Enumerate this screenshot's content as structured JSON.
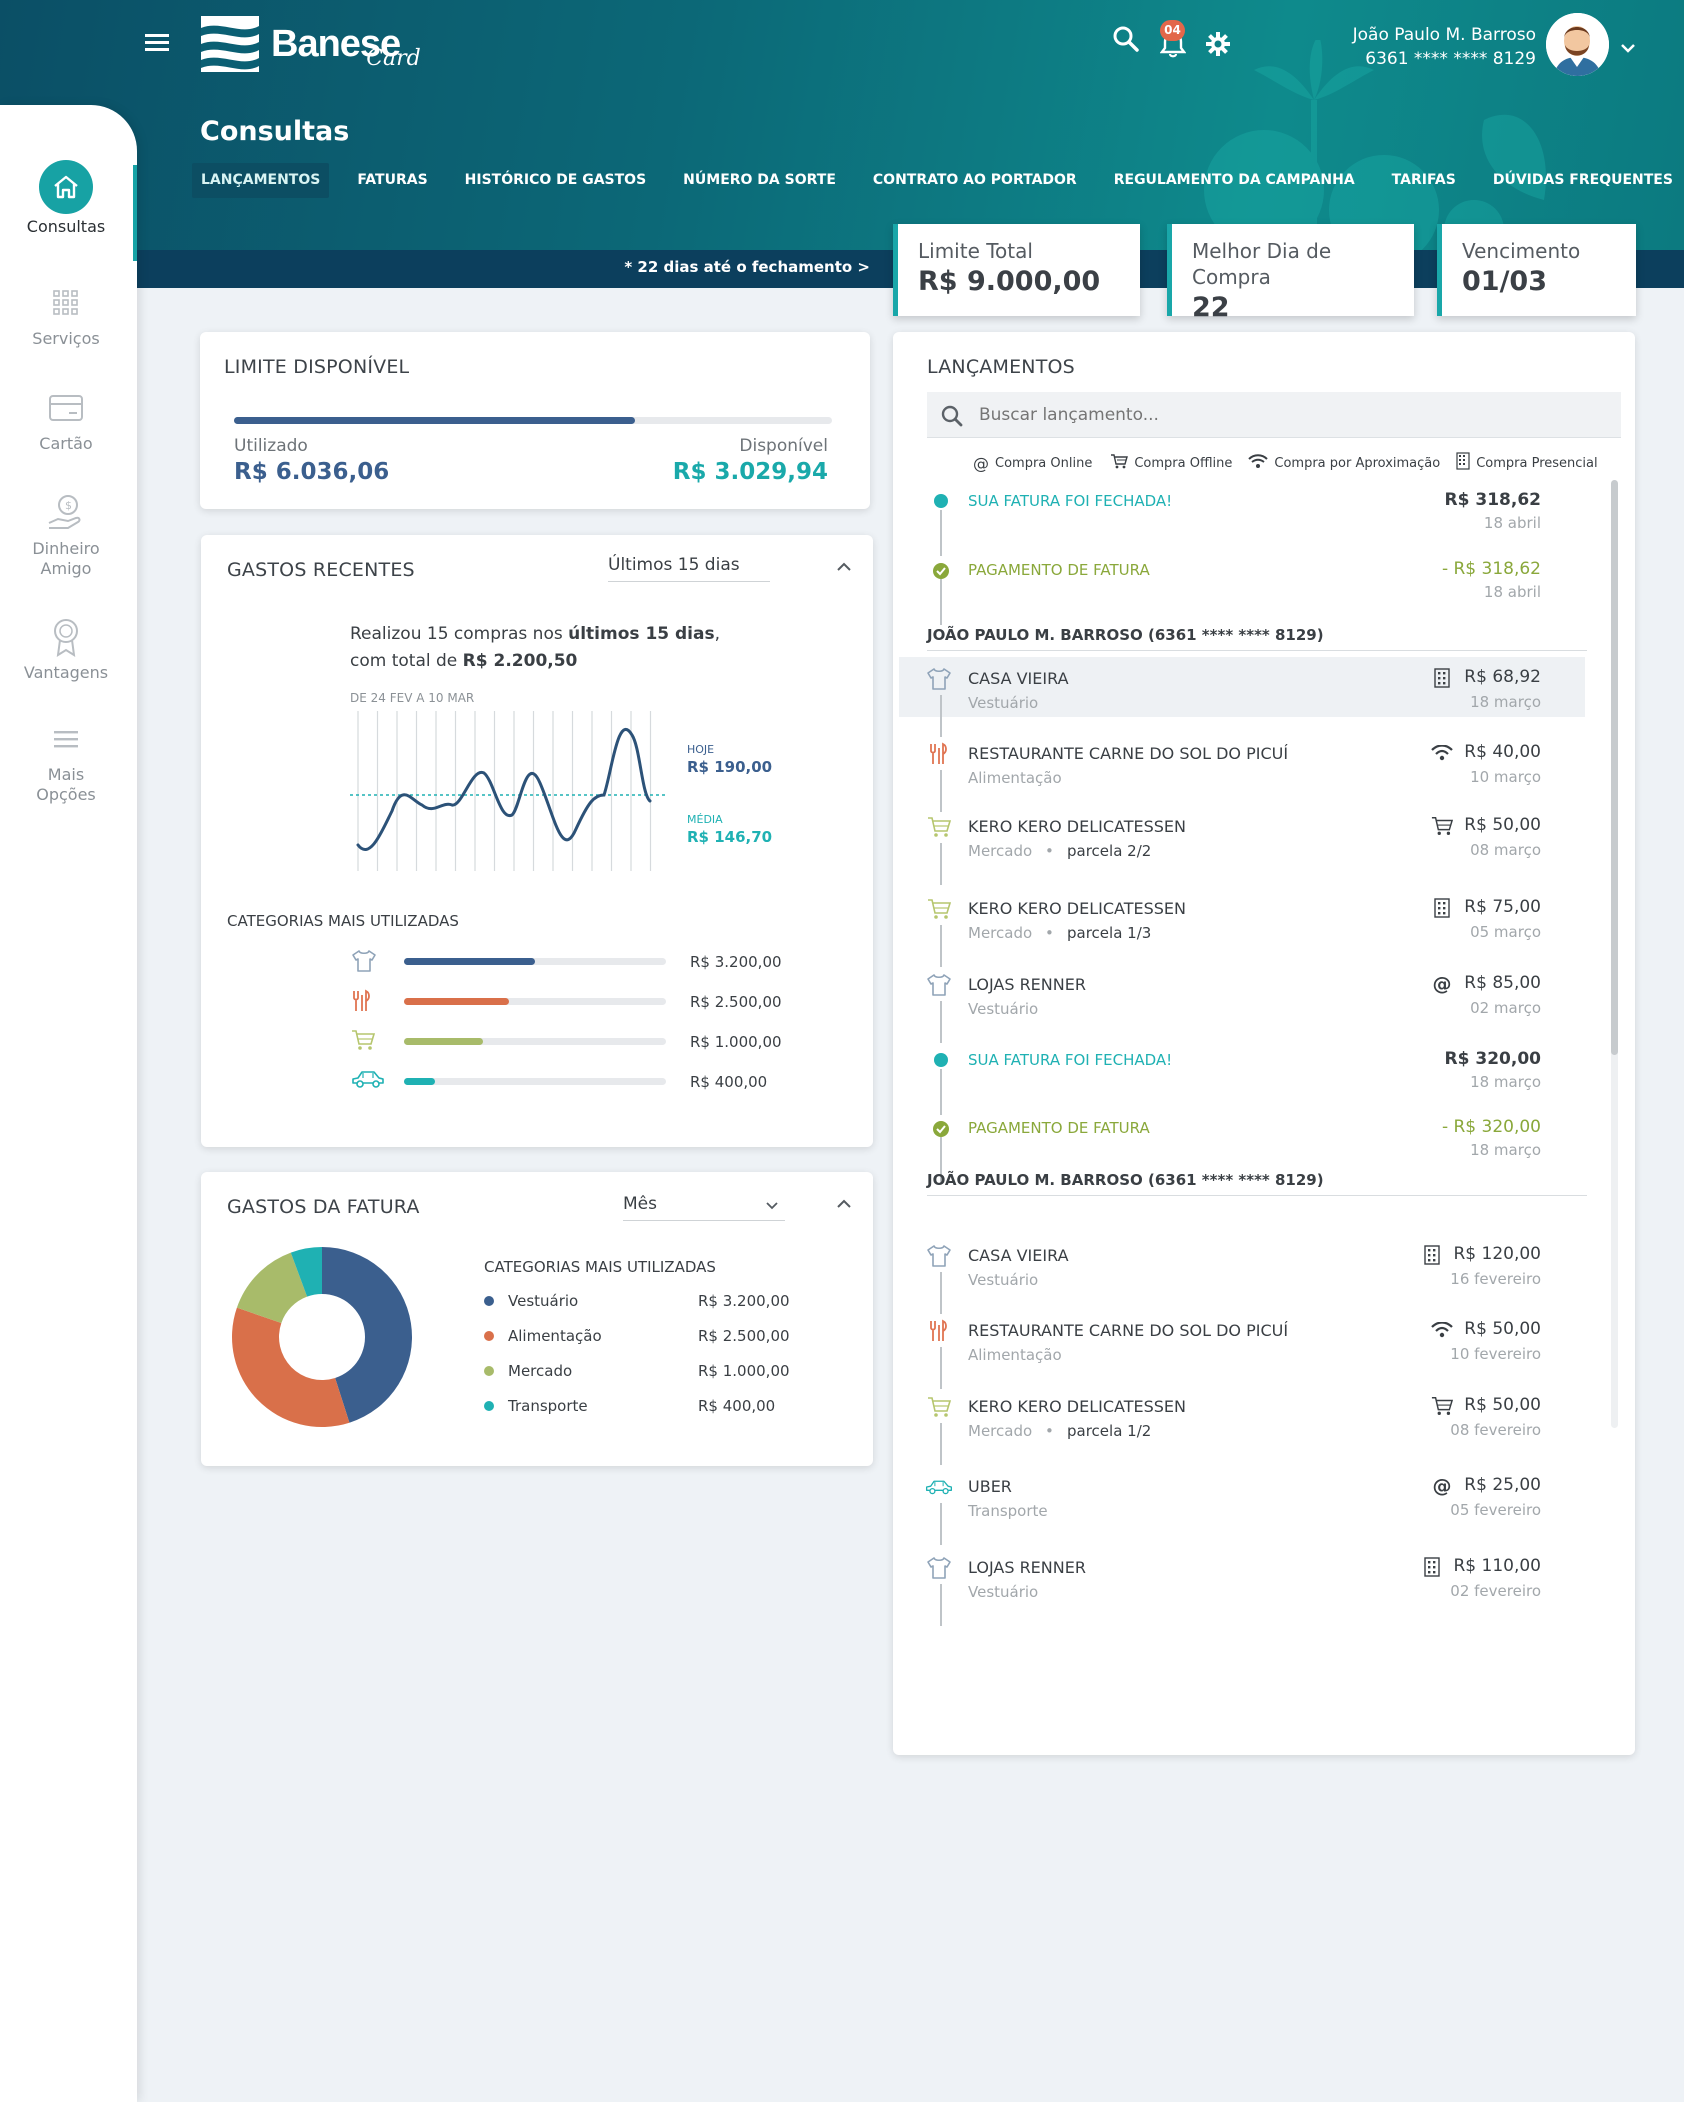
{
  "header": {
    "logo_text": "Banese",
    "logo_sub": "Card",
    "notification_count": "04",
    "user_name": "João Paulo M. Barroso",
    "card_number": "6361 **** **** 8129",
    "page_title": "Consultas",
    "tabs": [
      "LANÇAMENTOS",
      "FATURAS",
      "HISTÓRICO DE GASTOS",
      "NÚMERO DA SORTE",
      "CONTRATO AO PORTADOR",
      "REGULAMENTO DA CAMPANHA",
      "TARIFAS",
      "DÚVIDAS FREQUENTES"
    ],
    "active_tab": "LANÇAMENTOS",
    "strip_note": "* 22 dias até o fechamento >"
  },
  "sidebar": {
    "items": [
      {
        "label": "Consultas",
        "icon": "home-icon",
        "active": true
      },
      {
        "label": "Serviços",
        "icon": "grid-icon"
      },
      {
        "label": "Cartão",
        "icon": "card-icon"
      },
      {
        "label": "Dinheiro Amigo",
        "icon": "hand-coin-icon"
      },
      {
        "label": "Vantagens",
        "icon": "medal-icon"
      },
      {
        "label": "Mais Opções",
        "icon": "menu-icon"
      }
    ]
  },
  "info_cards": [
    {
      "label": "Limite Total",
      "value": "R$ 9.000,00"
    },
    {
      "label": "Melhor Dia de Compra",
      "value": "22"
    },
    {
      "label": "Vencimento",
      "value": "01/03"
    }
  ],
  "limite": {
    "title": "LIMITE DISPONÍVEL",
    "used_label": "Utilizado",
    "used_value": "R$ 6.036,06",
    "avail_label": "Disponível",
    "avail_value": "R$ 3.029,94",
    "used_fraction": 0.67
  },
  "gastos_recentes": {
    "title": "GASTOS RECENTES",
    "period": "Últimos 15 dias",
    "summary_pre": "Realizou 15 compras nos ",
    "summary_bold": "últimos 15 dias",
    "summary_mid": ",",
    "summary_line2_pre": "com total de ",
    "summary_total": "R$ 2.200,50",
    "range_label": "DE 24 FEV A 10 MAR",
    "hoje_label": "HOJE",
    "hoje_value": "R$ 190,00",
    "media_label": "MÉDIA",
    "media_value": "R$ 146,70",
    "cat_title": "CATEGORIAS MAIS UTILIZADAS",
    "categories": [
      {
        "icon": "shirt-icon",
        "value": "R$ 3.200,00",
        "fraction": 0.5,
        "color": "#3b5f8e"
      },
      {
        "icon": "cutlery-icon",
        "value": "R$ 2.500,00",
        "fraction": 0.4,
        "color": "#d9704a"
      },
      {
        "icon": "cart-icon",
        "value": "R$ 1.000,00",
        "fraction": 0.3,
        "color": "#a8bb6a"
      },
      {
        "icon": "car-icon",
        "value": "R$ 400,00",
        "fraction": 0.12,
        "color": "#1fb1b3"
      }
    ]
  },
  "gastos_fatura": {
    "title": "GASTOS DA FATURA",
    "period": "Mês",
    "cat_title": "CATEGORIAS MAIS UTILIZADAS",
    "categories": [
      {
        "label": "Vestuário",
        "value": "R$ 3.200,00",
        "color": "#3b5f8e"
      },
      {
        "label": "Alimentação",
        "value": "R$ 2.500,00",
        "color": "#d9704a"
      },
      {
        "label": "Mercado",
        "value": "R$ 1.000,00",
        "color": "#a8bb6a"
      },
      {
        "label": "Transporte",
        "value": "R$ 400,00",
        "color": "#1fb1b3"
      }
    ]
  },
  "lancamentos": {
    "title": "LANÇAMENTOS",
    "search_placeholder": "Buscar lançamento...",
    "legend": [
      "Compra Online",
      "Compra Offline",
      "Compra por Aproximação",
      "Compra Presencial"
    ],
    "group_label": "JOÃO PAULO M. BARROSO (6361 **** **** 8129)",
    "items": [
      {
        "type": "status",
        "kind": "closed",
        "name": "SUA FATURA FOI FECHADA!",
        "amount": "R$ 318,62",
        "date": "18 abril"
      },
      {
        "type": "status",
        "kind": "paid",
        "name": "PAGAMENTO DE FATURA",
        "amount": "- R$ 318,62",
        "date": "18 abril"
      },
      {
        "type": "group"
      },
      {
        "type": "tx",
        "icon": "shirt-icon",
        "mode": "building-icon",
        "name": "CASA VIEIRA",
        "cat": "Vestuário",
        "amount": "R$ 68,92",
        "date": "18 março",
        "highlight": true
      },
      {
        "type": "tx",
        "icon": "cutlery-icon",
        "mode": "wifi-icon",
        "name": "RESTAURANTE CARNE DO SOL DO PICUÍ",
        "cat": "Alimentação",
        "amount": "R$ 40,00",
        "date": "10 março"
      },
      {
        "type": "tx",
        "icon": "cart-icon",
        "mode": "cart-icon",
        "name": "KERO KERO DELICATESSEN",
        "cat": "Mercado",
        "parcela": "parcela 2/2",
        "amount": "R$ 50,00",
        "date": "08 março"
      },
      {
        "type": "tx",
        "icon": "cart-icon",
        "mode": "building-icon",
        "name": "KERO KERO DELICATESSEN",
        "cat": "Mercado",
        "parcela": "parcela 1/3",
        "amount": "R$ 75,00",
        "date": "05 março"
      },
      {
        "type": "tx",
        "icon": "shirt-icon",
        "mode": "at-icon",
        "name": "LOJAS RENNER",
        "cat": "Vestuário",
        "amount": "R$ 85,00",
        "date": "02 março"
      },
      {
        "type": "status",
        "kind": "closed",
        "name": "SUA FATURA FOI FECHADA!",
        "amount": "R$ 320,00",
        "date": "18 março"
      },
      {
        "type": "status",
        "kind": "paid",
        "name": "PAGAMENTO DE FATURA",
        "amount": "- R$ 320,00",
        "date": "18 março"
      },
      {
        "type": "group"
      },
      {
        "type": "tx",
        "icon": "shirt-icon",
        "mode": "building-icon",
        "name": "CASA VIEIRA",
        "cat": "Vestuário",
        "amount": "R$ 120,00",
        "date": "16 fevereiro"
      },
      {
        "type": "tx",
        "icon": "cutlery-icon",
        "mode": "wifi-icon",
        "name": "RESTAURANTE CARNE DO SOL DO PICUÍ",
        "cat": "Alimentação",
        "amount": "R$ 50,00",
        "date": "10 fevereiro"
      },
      {
        "type": "tx",
        "icon": "cart-icon",
        "mode": "cart-icon",
        "name": "KERO KERO DELICATESSEN",
        "cat": "Mercado",
        "parcela": "parcela 1/2",
        "amount": "R$ 50,00",
        "date": "08 fevereiro"
      },
      {
        "type": "tx",
        "icon": "car-icon",
        "mode": "at-icon",
        "name": "UBER",
        "cat": "Transporte",
        "amount": "R$ 25,00",
        "date": "05 fevereiro"
      },
      {
        "type": "tx",
        "icon": "shirt-icon",
        "mode": "building-icon",
        "name": "LOJAS RENNER",
        "cat": "Vestuário",
        "amount": "R$ 110,00",
        "date": "02 fevereiro"
      }
    ]
  }
}
